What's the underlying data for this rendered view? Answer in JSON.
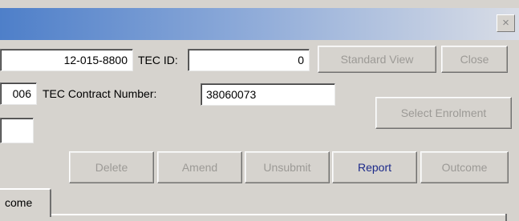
{
  "window": {
    "close_glyph": "×"
  },
  "fields": {
    "phone_value": "12-015-8800",
    "tec_id_label": "TEC ID:",
    "tec_id_value": "0",
    "row2_partial_value": "006",
    "contract_label": "TEC Contract Number:",
    "contract_value": "38060073",
    "row3_partial_value": ""
  },
  "buttons": {
    "standard_view": "Standard View",
    "close": "Close",
    "select_enrolment": "Select Enrolment",
    "delete": "Delete",
    "amend": "Amend",
    "unsubmit": "Unsubmit",
    "report": "Report",
    "outcome": "Outcome"
  },
  "tabs": {
    "outcome_partial": "come"
  },
  "colors": {
    "title_gradient_start": "#4e7fc9",
    "title_gradient_end": "#d9dde6",
    "enabled_button_text": "#1c2a8a",
    "disabled_button_text": "#9c9a96"
  }
}
